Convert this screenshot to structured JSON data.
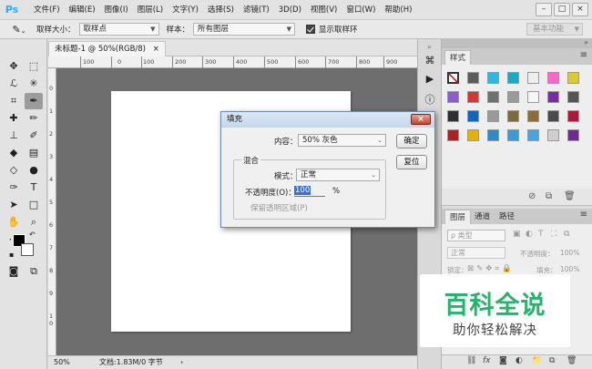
{
  "app": {
    "logo": "Ps",
    "window_controls": [
      "–",
      "□",
      "×"
    ]
  },
  "menu": [
    "文件(F)",
    "编辑(E)",
    "图像(I)",
    "图层(L)",
    "文字(Y)",
    "选择(S)",
    "滤镜(T)",
    "3D(D)",
    "视图(V)",
    "窗口(W)",
    "帮助(H)"
  ],
  "options": {
    "sample_size_label": "取样大小：",
    "sample_size_value": "取样点",
    "sample_label": "样本：",
    "sample_value": "所有图层",
    "show_ring_label": "显示取样环",
    "workspace": "基本功能"
  },
  "document": {
    "tab_title": "未标题-1 @ 50%(RGB/8)",
    "tab_close": "×",
    "ruler_top": [
      "100",
      "0",
      "100",
      "200",
      "300",
      "400",
      "500",
      "600",
      "700",
      "800",
      "900"
    ],
    "ruler_left": [
      "0",
      "1",
      "2",
      "3",
      "4",
      "5",
      "6",
      "7",
      "8",
      "9",
      "1",
      "0"
    ],
    "zoom": "50%",
    "doc_info": "文档:1.83M/0 字节",
    "doc_info_arrow": "›"
  },
  "styles_panel": {
    "tab": "样式",
    "colors": [
      "#ffffff",
      "#5c5c5c",
      "#2fb7e0",
      "#1ea8c8",
      "#eeeeee",
      "#ff66cc",
      "#d8c93a",
      "#8c5bd1",
      "#d43535",
      "#707070",
      "#9a9a9a",
      "#f5f5f5",
      "#7a2ca8",
      "#555555",
      "#2f2f2f",
      "#1565c0",
      "#9a9a9a",
      "#7a6a3e",
      "#8a6d3c",
      "#4a4a4a",
      "#b0183a",
      "#b02020",
      "#e5b200",
      "#2d8bc6",
      "#3a9bd8",
      "#4aa3e0",
      "#cfcfcf",
      "#6d2b8f"
    ]
  },
  "layers_panel": {
    "tabs": [
      "图层",
      "通道",
      "路径"
    ],
    "kind_label": "ρ 类型",
    "blend_mode": "正常",
    "opacity_label": "不透明度：",
    "opacity_value": "100%",
    "lock_label": "锁定：",
    "fill_label": "填充：",
    "fill_value": "100%"
  },
  "fill_dialog": {
    "title": "填充",
    "close": "×",
    "content_label": "内容：",
    "content_value": "50% 灰色",
    "ok": "确定",
    "reset": "复位",
    "blend_group": "混合",
    "mode_label": "模式：",
    "mode_value": "正常",
    "opacity_label": "不透明度(O)：",
    "opacity_value": "100",
    "percent": "%",
    "preserve_label": "保留透明区域(P)"
  },
  "watermark": {
    "main": "百科全说",
    "sub": "助你轻松解决"
  }
}
